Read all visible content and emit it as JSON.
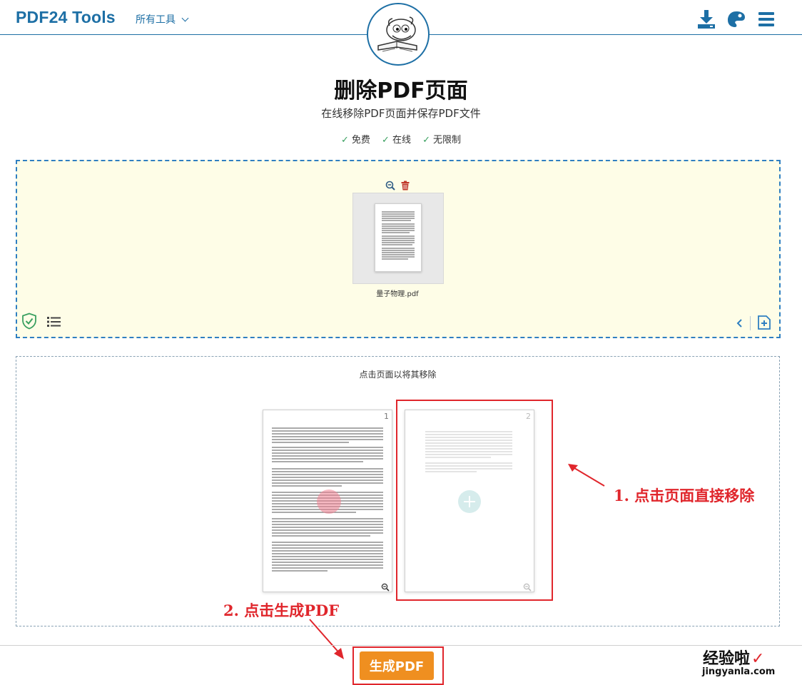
{
  "header": {
    "logo": "PDF24 Tools",
    "all_tools": "所有工具"
  },
  "main": {
    "title": "删除PDF页面",
    "subtitle": "在线移除PDF页面并保存PDF文件",
    "features": [
      "免费",
      "在线",
      "无限制"
    ]
  },
  "upload": {
    "file_name": "量子物理.pdf"
  },
  "pages": {
    "hint": "点击页面以将其移除",
    "items": [
      {
        "number": "1"
      },
      {
        "number": "2"
      }
    ]
  },
  "annotations": {
    "step1": "1. 点击页面直接移除",
    "step2": "2. 点击生成PDF"
  },
  "actions": {
    "generate": "生成PDF"
  },
  "watermark": {
    "text": "经验啦",
    "check": "✓",
    "url": "jingyanla.com"
  },
  "colors": {
    "brand_blue": "#1d6fa5",
    "accent_orange": "#ef8f20",
    "annotation_red": "#e0262c",
    "dropzone_bg": "#fefde7"
  }
}
